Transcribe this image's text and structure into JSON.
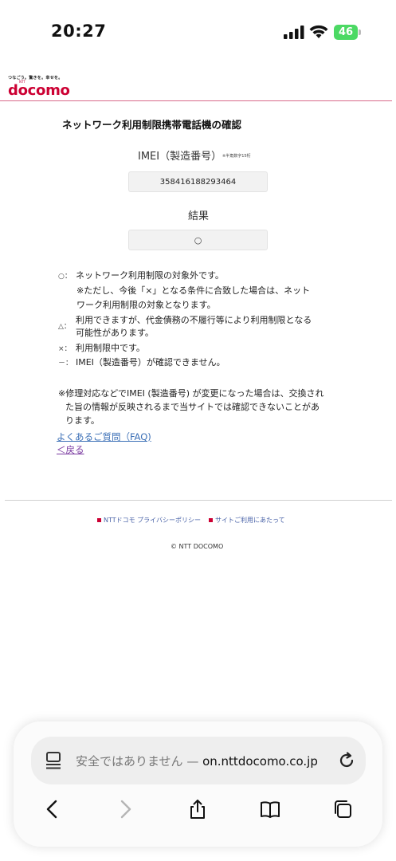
{
  "status_bar": {
    "time": "20:27",
    "battery": "46"
  },
  "header": {
    "tagline": "つなごう。驚きを。幸せを。",
    "ntt_mark": "NTT",
    "logo": "docomo"
  },
  "page": {
    "title": "ネットワーク利用制限携帯電話機の確認",
    "imei_label": "IMEI（製造番号）",
    "imei_note": "※半角数字15桁",
    "imei_value": "358416188293464",
    "result_label": "結果",
    "result_value": "○"
  },
  "legend": {
    "circle_symbol": "○：",
    "circle_text": "ネットワーク利用制限の対象外です。",
    "circle_note_1": "※ただし、今後「×」となる条件に合致した場合は、ネット",
    "circle_note_2": "ワーク利用制限の対象となります。",
    "triangle_symbol": "△：",
    "triangle_text_1": "利用できますが、代金債務の不履行等により利用制限となる",
    "triangle_text_2": "可能性があります。",
    "cross_symbol": "×：",
    "cross_text": "利用制限中です。",
    "dash_symbol": "－：",
    "dash_text": "IMEI（製造番号）が確認できません。"
  },
  "footnote": {
    "line1": "※修理対応などでIMEI (製造番号) が変更になった場合は、交換され",
    "line2": "た旨の情報が反映されるまで当サイトでは確認できないことがあ",
    "line3": "ります。"
  },
  "links": {
    "faq": "よくあるご質問（FAQ)",
    "back": "＜戻る"
  },
  "footer": {
    "link1": "NTTドコモ プライバシーポリシー",
    "link2": "サイトご利用にあたって",
    "copyright": "© NTT DOCOMO"
  },
  "browser": {
    "security_text": "安全ではありません — ",
    "domain": "on.nttdocomo.co.jp"
  }
}
